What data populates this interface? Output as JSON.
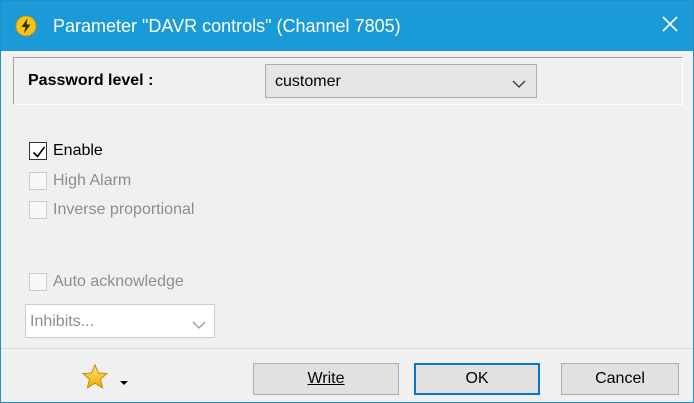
{
  "window": {
    "title": "Parameter \"DAVR controls\" (Channel 7805)",
    "title_icon": "lightning-icon",
    "close_icon": "close-icon"
  },
  "password": {
    "label": "Password level :",
    "selected": "customer"
  },
  "options": [
    {
      "label": "Enable",
      "checked": true,
      "enabled": true
    },
    {
      "label": "High Alarm",
      "checked": false,
      "enabled": false
    },
    {
      "label": "Inverse proportional",
      "checked": false,
      "enabled": false
    },
    {
      "label": "Auto acknowledge",
      "checked": false,
      "enabled": false
    }
  ],
  "inhibits": {
    "selected": "Inhibits..."
  },
  "footer": {
    "favorites_icon": "star-icon",
    "write_label": "Write",
    "ok_label": "OK",
    "cancel_label": "Cancel"
  },
  "colors": {
    "titlebar": "#1a9ad6",
    "default_button_border": "#0078d7"
  }
}
